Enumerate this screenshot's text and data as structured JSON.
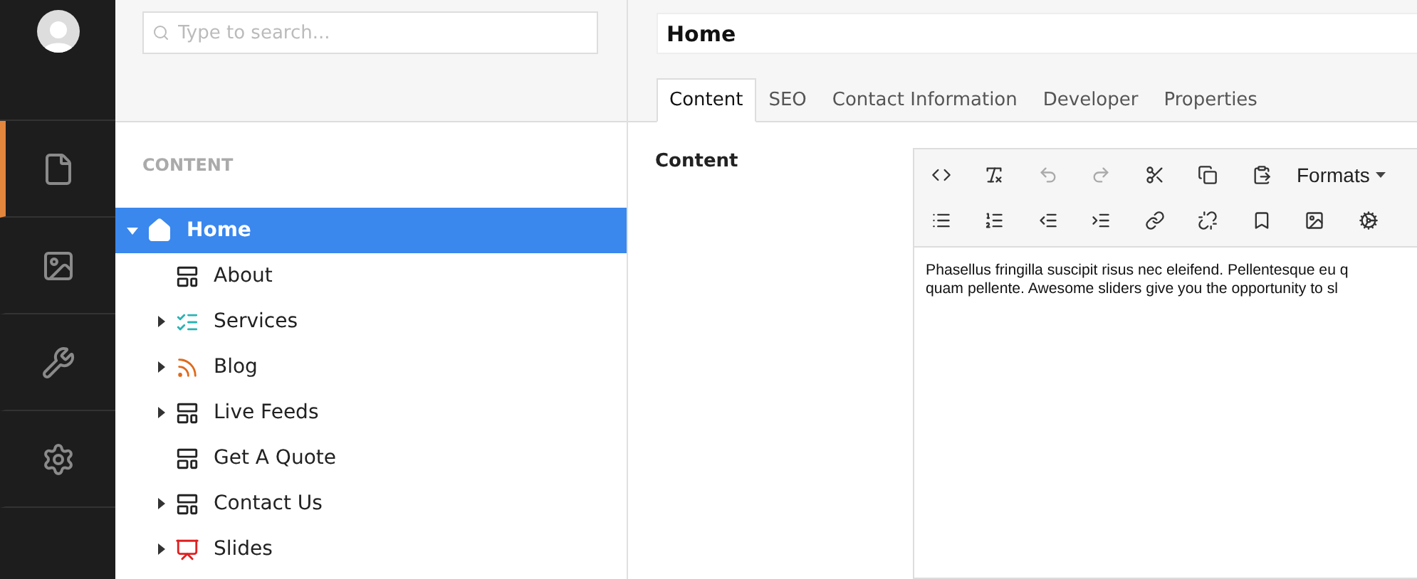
{
  "rail": {
    "items": [
      {
        "selected": true
      },
      {
        "selected": false
      },
      {
        "selected": false
      },
      {
        "selected": false
      }
    ]
  },
  "search": {
    "placeholder": "Type to search..."
  },
  "tree": {
    "heading": "CONTENT",
    "items": [
      {
        "label": "Home",
        "kind": "home",
        "selected": true,
        "expanded": true,
        "children": [
          {
            "label": "About",
            "kind": "page",
            "selected": false,
            "expanded": false,
            "has_children": false
          },
          {
            "label": "Services",
            "kind": "list",
            "selected": false,
            "expanded": false,
            "has_children": true
          },
          {
            "label": "Blog",
            "kind": "feed",
            "selected": false,
            "expanded": false,
            "has_children": true
          },
          {
            "label": "Live Feeds",
            "kind": "page",
            "selected": false,
            "expanded": false,
            "has_children": true
          },
          {
            "label": "Get A Quote",
            "kind": "page",
            "selected": false,
            "expanded": false,
            "has_children": false
          },
          {
            "label": "Contact Us",
            "kind": "page",
            "selected": false,
            "expanded": false,
            "has_children": true
          },
          {
            "label": "Slides",
            "kind": "slides",
            "selected": false,
            "expanded": false,
            "has_children": true
          }
        ],
        "has_children": true
      }
    ]
  },
  "editor": {
    "name_value": "Home",
    "tabs": [
      {
        "label": "Content",
        "selected": true
      },
      {
        "label": "SEO",
        "selected": false
      },
      {
        "label": "Contact Information",
        "selected": false
      },
      {
        "label": "Developer",
        "selected": false
      },
      {
        "label": "Properties",
        "selected": false
      }
    ],
    "field_label": "Content",
    "toolbar_row_1": [
      {
        "disabled": false
      },
      {
        "disabled": false
      },
      {
        "disabled": true
      },
      {
        "disabled": true
      },
      {
        "disabled": false
      },
      {
        "disabled": false
      },
      {
        "disabled": false
      }
    ],
    "formats": "Formats",
    "toolbar_row_2": [
      {
        "disabled": false
      },
      {
        "disabled": false
      },
      {
        "disabled": false
      },
      {
        "disabled": false
      },
      {
        "disabled": false
      },
      {
        "disabled": false
      },
      {
        "disabled": false
      },
      {
        "disabled": false
      },
      {
        "disabled": false
      }
    ],
    "text_lines": [
      "Phasellus fringilla suscipit risus nec eleifend. Pellentesque eu q",
      "quam pellente. Awesome sliders give you the opportunity to sl"
    ]
  }
}
